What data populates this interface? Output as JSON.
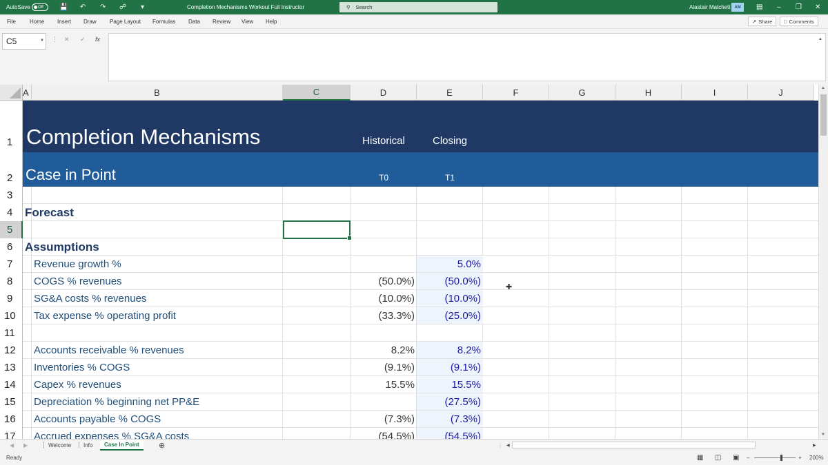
{
  "titlebar": {
    "autosave_label": "AutoSave",
    "autosave_state": "Off",
    "doc_title": "Completion Mechanisms Workout Full Instructor",
    "search_placeholder": "Search",
    "user_name": "Alastair Matchett",
    "user_initials": "AM",
    "accent": "#217346"
  },
  "menu": {
    "items": [
      "File",
      "Home",
      "Insert",
      "Draw",
      "Page Layout",
      "Formulas",
      "Data",
      "Review",
      "View",
      "Help"
    ],
    "share_label": "Share",
    "comments_label": "Comments"
  },
  "formula_bar": {
    "name_box": "C5",
    "formula": ""
  },
  "columns": [
    "A",
    "B",
    "C",
    "D",
    "E",
    "F",
    "G",
    "H",
    "I",
    "J"
  ],
  "selected_column": "C",
  "selected_cell": "C5",
  "rows": [
    "1",
    "2",
    "3",
    "4",
    "5",
    "6",
    "7",
    "8",
    "9",
    "10",
    "11",
    "12",
    "13",
    "14",
    "15",
    "16",
    "17"
  ],
  "sheet": {
    "title": "Completion Mechanisms",
    "subtitle": "Case in Point",
    "header_d": "Historical",
    "header_e": "Closing",
    "period_d": "T0",
    "period_e": "T1",
    "forecast": "Forecast",
    "assumptions": "Assumptions",
    "band_dark": "#1f3864",
    "band_mid": "#1f5c99",
    "lines": [
      {
        "row": 7,
        "label": "Revenue growth %",
        "d": "",
        "e": "5.0%"
      },
      {
        "row": 8,
        "label": "COGS % revenues",
        "d": "(50.0%)",
        "e": "(50.0%)"
      },
      {
        "row": 9,
        "label": "SG&A costs % revenues",
        "d": "(10.0%)",
        "e": "(10.0%)"
      },
      {
        "row": 10,
        "label": "Tax expense % operating profit",
        "d": "(33.3%)",
        "e": "(25.0%)"
      },
      {
        "row": 12,
        "label": "Accounts receivable % revenues",
        "d": "8.2%",
        "e": "8.2%"
      },
      {
        "row": 13,
        "label": "Inventories % COGS",
        "d": "(9.1%)",
        "e": "(9.1%)"
      },
      {
        "row": 14,
        "label": "Capex % revenues",
        "d": "15.5%",
        "e": "15.5%"
      },
      {
        "row": 15,
        "label": "Depreciation % beginning net PP&E",
        "d": "",
        "e": "(27.5%)"
      },
      {
        "row": 16,
        "label": "Accounts payable % COGS",
        "d": "(7.3%)",
        "e": "(7.3%)"
      },
      {
        "row": 17,
        "label": "Accrued expenses % SG&A costs",
        "d": "(54.5%)",
        "e": "(54.5%)"
      }
    ]
  },
  "tabs": {
    "items": [
      "Welcome",
      "Info",
      "Case In Point"
    ],
    "active": "Case In Point"
  },
  "status": {
    "ready": "Ready",
    "zoom": "200%"
  }
}
